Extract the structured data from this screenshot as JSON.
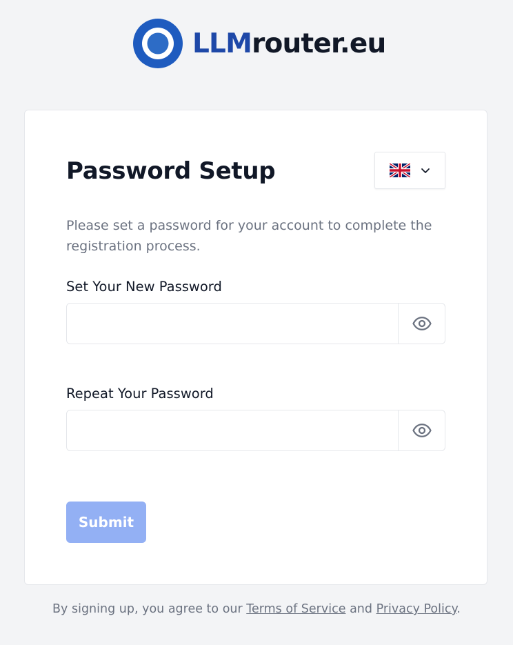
{
  "logo": {
    "brand": "LLM",
    "rest": "router.eu",
    "icon": "llmrouter-logo-icon",
    "colors": {
      "brand": "#1e48a8",
      "ring_outer": "#1e5bbf",
      "ring_inner": "#2d6cc6"
    }
  },
  "form": {
    "title": "Password Setup",
    "description": "Please set a password for your account to complete the registration process.",
    "language": {
      "flag_icon": "uk-flag-icon",
      "selected": "English"
    },
    "password": {
      "label": "Set Your New Password",
      "value": "",
      "placeholder": "",
      "toggle_icon": "eye-icon"
    },
    "repeat_password": {
      "label": "Repeat Your Password",
      "value": "",
      "placeholder": "",
      "toggle_icon": "eye-icon"
    },
    "submit_label": "Submit",
    "submit_color": "#93b0f4"
  },
  "footer": {
    "prefix": "By signing up, you agree to our",
    "terms": "Terms of Service",
    "conjunction": "and",
    "privacy": "Privacy Policy",
    "suffix": "."
  }
}
